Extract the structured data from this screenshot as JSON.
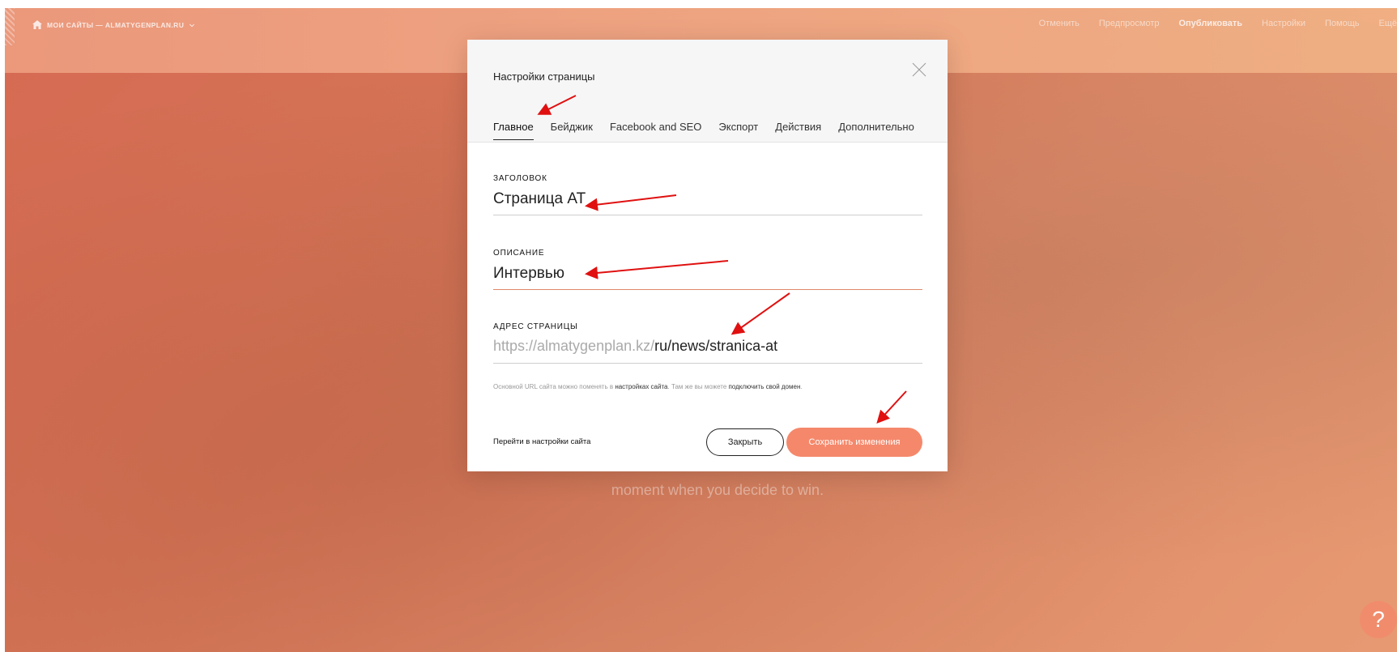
{
  "topbar": {
    "breadcrumb": "МОИ САЙТЫ — ALMATYGENPLAN.RU",
    "actions": [
      "Отменить",
      "Предпросмотр",
      "Опубликовать",
      "Настройки",
      "Помощь",
      "Ещё"
    ]
  },
  "hero": {
    "title": "",
    "subtitle": "moment when you decide to win."
  },
  "modal": {
    "title": "Настройки страницы",
    "tabs": [
      "Главное",
      "Бейджик",
      "Facebook and SEO",
      "Экспорт",
      "Действия",
      "Дополнительно"
    ],
    "active_tab": "Главное",
    "title_field": {
      "label": "ЗАГОЛОВОК",
      "value": "Страница AT"
    },
    "description_field": {
      "label": "ОПИСАНИЕ",
      "value": "Интервью"
    },
    "address_field": {
      "label": "АДРЕС СТРАНИЦЫ",
      "prefix": "https://almatygenplan.kz/",
      "path": "ru/news/stranica-at"
    },
    "hint": {
      "part1": "Основной URL сайта можно поменять в ",
      "link1": "настройках сайта",
      "part2": ". Там же вы можете ",
      "link2": "подключить свой домен",
      "part3": "."
    },
    "site_settings_link": "Перейти в настройки сайта",
    "close_button": "Закрыть",
    "save_button": "Сохранить изменения"
  },
  "help_icon": "?",
  "colors": {
    "accent": "#f5886b",
    "annotation_arrow": "#e01010"
  }
}
